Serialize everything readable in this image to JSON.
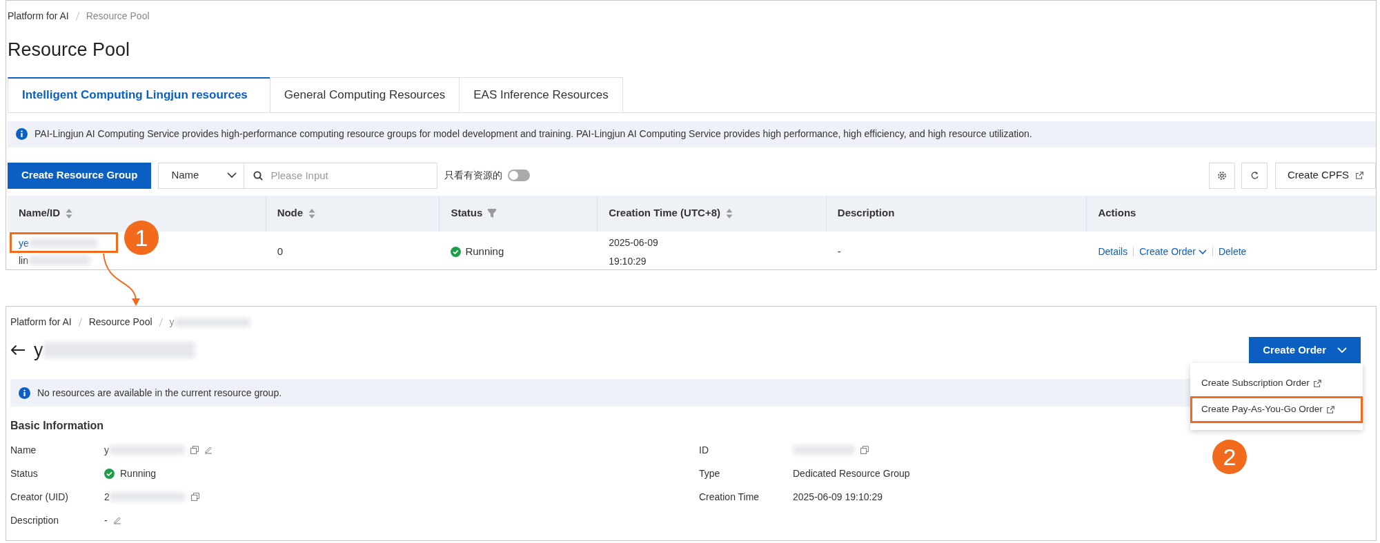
{
  "list_page": {
    "breadcrumb": [
      {
        "label": "Platform for AI",
        "current": false
      },
      {
        "label": "Resource Pool",
        "current": true
      }
    ],
    "title": "Resource Pool",
    "tabs": [
      {
        "label": "Intelligent Computing Lingjun resources",
        "selected": true
      },
      {
        "label": "General Computing Resources",
        "selected": false
      },
      {
        "label": "EAS Inference Resources",
        "selected": false
      }
    ],
    "notice": "PAI-Lingjun AI Computing Service provides high-performance computing resource groups for model development and training. PAI-Lingjun AI Computing Service provides high performance, high efficiency, and high resource utilization.",
    "toolbar": {
      "create_button": "Create Resource Group",
      "filter_select": "Name",
      "search_placeholder": "Please Input",
      "toggle_label": "只看有资源的",
      "toggle_on": false,
      "cpfs_button": "Create CPFS"
    },
    "table": {
      "columns": [
        {
          "label": "Name/ID",
          "kind": "sort"
        },
        {
          "label": "Node",
          "kind": "sort"
        },
        {
          "label": "Status",
          "kind": "filter"
        },
        {
          "label": "Creation Time (UTC+8)",
          "kind": "sort"
        },
        {
          "label": "Description",
          "kind": "plain"
        },
        {
          "label": "Actions",
          "kind": "plain"
        }
      ],
      "rows": [
        {
          "name": "ye",
          "id": "lin",
          "redacted": true,
          "node": "0",
          "status": "Running",
          "creation_date": "2025-06-09",
          "creation_time": "19:10:29",
          "description": "-",
          "actions": [
            {
              "label": "Details",
              "kind": "link"
            },
            {
              "label": "Create Order",
              "kind": "dropdown"
            },
            {
              "label": "Delete",
              "kind": "link"
            }
          ]
        }
      ]
    }
  },
  "annotations": [
    {
      "label": "1"
    },
    {
      "label": "2"
    }
  ],
  "detail_page": {
    "breadcrumb": [
      {
        "label": "Platform for AI",
        "current": false
      },
      {
        "label": "Resource Pool",
        "current": false
      },
      {
        "label": "y",
        "current": true,
        "redacted": true
      }
    ],
    "title": "y",
    "title_redacted": true,
    "create_order_button": "Create Order",
    "menu": [
      {
        "label": "Create Subscription Order",
        "highlighted": false
      },
      {
        "label": "Create Pay-As-You-Go Order",
        "highlighted": true
      }
    ],
    "notice": "No resources are available in the current resource group.",
    "section_title": "Basic Information",
    "fields_left": [
      {
        "label": "Name",
        "value": "y",
        "kind": "text",
        "redacted": true,
        "copy": true,
        "edit": true
      },
      {
        "label": "Status",
        "value": "Running",
        "kind": "status",
        "redacted": false,
        "copy": false,
        "edit": false
      },
      {
        "label": "Creator (UID)",
        "value": "2",
        "kind": "text",
        "redacted": true,
        "copy": true,
        "edit": false
      },
      {
        "label": "Description",
        "value": "-",
        "kind": "text",
        "redacted": false,
        "copy": false,
        "edit": true
      }
    ],
    "fields_right": [
      {
        "label": "ID",
        "kind": "text",
        "redacted": true,
        "copy": true,
        "edit": false
      },
      {
        "label": "Type",
        "value": "Dedicated Resource Group",
        "kind": "text",
        "redacted": false,
        "copy": false,
        "edit": false
      },
      {
        "label": "Creation Time",
        "value": "2025-06-09 19:10:29",
        "kind": "text",
        "redacted": false,
        "copy": false,
        "edit": false
      }
    ]
  }
}
